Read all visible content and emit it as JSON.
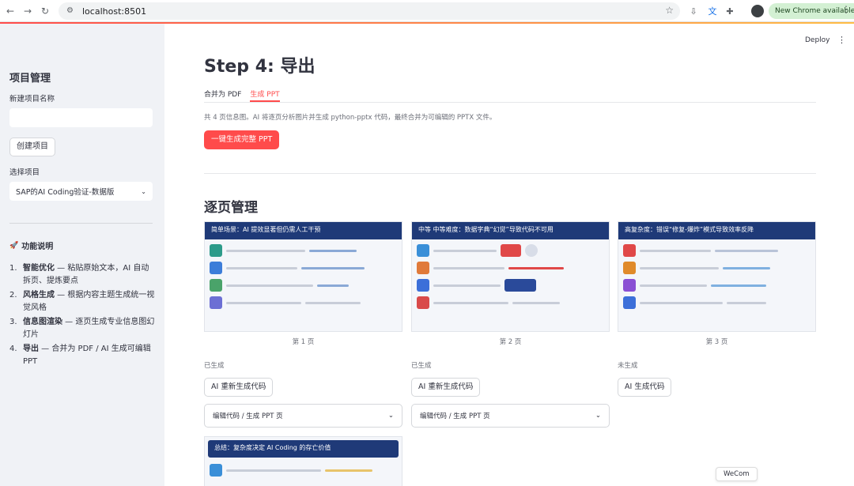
{
  "browser": {
    "url": "localhost:8501",
    "update_label": "New Chrome available"
  },
  "sidebar": {
    "title": "项目管理",
    "new_project_label": "新建项目名称",
    "create_button": "创建项目",
    "select_label": "选择项目",
    "selected_project": "SAP的AI Coding验证-数据版",
    "features_title": "功能说明",
    "features": [
      {
        "num": "1.",
        "name": "智能优化",
        "desc": " — 粘贴原始文本，AI 自动拆页、提炼要点"
      },
      {
        "num": "2.",
        "name": "风格生成",
        "desc": " — 根据内容主题生成统一视觉风格"
      },
      {
        "num": "3.",
        "name": "信息图渲染",
        "desc": " — 逐页生成专业信息图幻灯片"
      },
      {
        "num": "4.",
        "name": "导出",
        "desc": " — 合并为 PDF / AI 生成可编辑 PPT"
      }
    ]
  },
  "header": {
    "deploy": "Deploy"
  },
  "main": {
    "title": "Step 4: 导出",
    "tabs": [
      "合并为 PDF",
      "生成 PPT"
    ],
    "description": "共 4 页信息图。AI 将逐页分析图片并生成 python-pptx 代码，最终合并为可编辑的 PPTX 文件。",
    "generate_all": "一键生成完整 PPT",
    "section_title": "逐页管理",
    "expander_label": "编辑代码 / 生成 PPT 页",
    "pages": [
      {
        "thumb_title": "简单场景：AI 提效显著但仍需人工干预",
        "caption": "第 1 页",
        "status": "已生成",
        "button": "AI 重新生成代码",
        "header_color": "#1f3a78"
      },
      {
        "thumb_title": "中等    中等难度：数据字典“幻觉”导致代码不可用",
        "caption": "第 2 页",
        "status": "已生成",
        "button": "AI 重新生成代码",
        "header_color": "#1f3a78"
      },
      {
        "thumb_title": "高复杂度：错误“修复-爆炸”模式导致效率反降",
        "caption": "第 3 页",
        "status": "未生成",
        "button": "AI 生成代码",
        "header_color": "#1f3a78"
      },
      {
        "thumb_title": "总结：复杂度决定 AI Coding 的存亡价值",
        "header_color": "#1f3a78"
      }
    ]
  },
  "wecom": "WeCom"
}
